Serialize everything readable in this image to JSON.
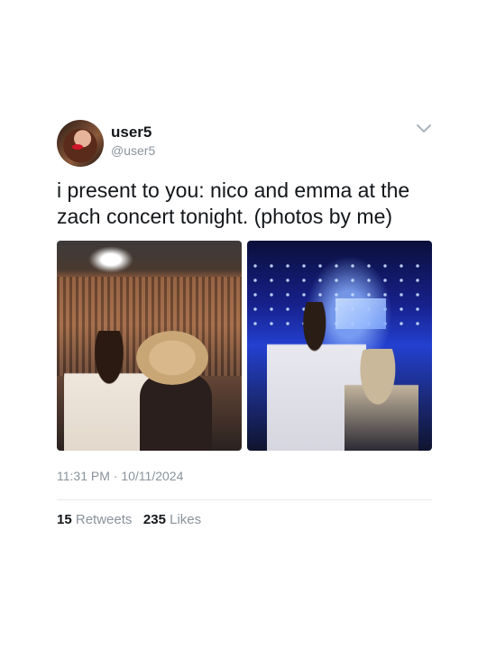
{
  "user": {
    "name": "user5",
    "handle": "@user5"
  },
  "tweet": {
    "text": "i present to you: nico and emma at the zach concert tonight. (photos by me)",
    "time": "11:31 PM",
    "date": "10/11/2024",
    "separator": "·"
  },
  "stats": {
    "retweets_count": "15",
    "retweets_label": "Retweets",
    "likes_count": "235",
    "likes_label": "Likes"
  },
  "icons": {
    "menu": "chevron-down-icon"
  },
  "colors": {
    "text": "#14171a",
    "secondary": "#8a939c",
    "divider": "#e6ecf0"
  }
}
